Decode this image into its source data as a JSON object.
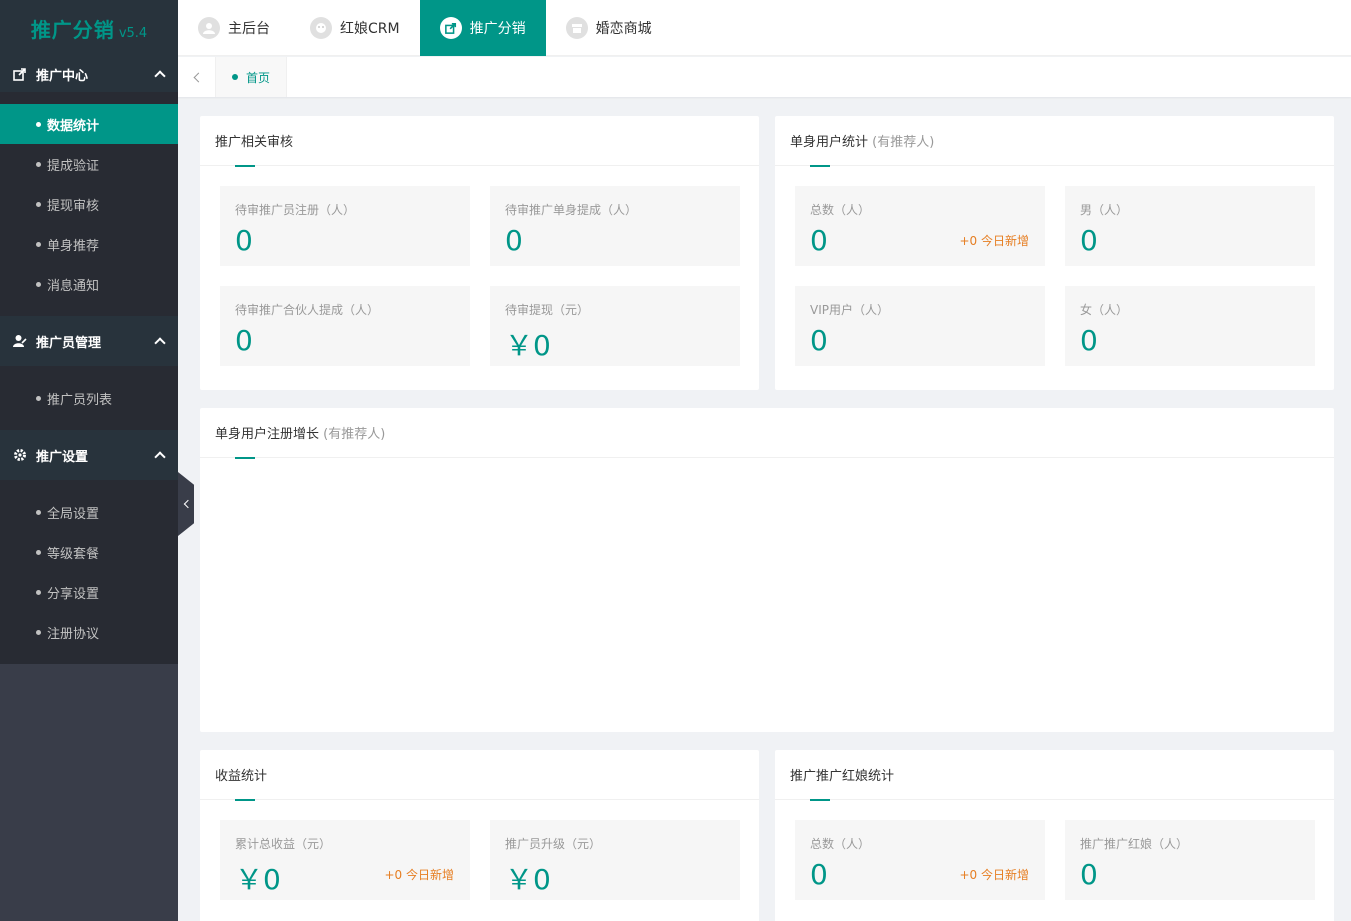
{
  "brand": {
    "title": "推广分销",
    "version": "v5.4"
  },
  "sidebar": {
    "groups": [
      {
        "label": "推广中心",
        "items": [
          "数据统计",
          "提成验证",
          "提现审核",
          "单身推荐",
          "消息通知"
        ]
      },
      {
        "label": "推广员管理",
        "items": [
          "推广员列表"
        ]
      },
      {
        "label": "推广设置",
        "items": [
          "全局设置",
          "等级套餐",
          "分享设置",
          "注册协议"
        ]
      }
    ]
  },
  "topnav": {
    "tabs": [
      "主后台",
      "红娘CRM",
      "推广分销",
      "婚恋商城"
    ],
    "active": "推广分销"
  },
  "breadcrumb": {
    "home": "首页"
  },
  "cards": {
    "audit": {
      "title": "推广相关审核",
      "stats": [
        {
          "label": "待审推广员注册（人）",
          "value": "0"
        },
        {
          "label": "待审推广单身提成（人）",
          "value": "0"
        },
        {
          "label": "待审推广合伙人提成（人）",
          "value": "0"
        },
        {
          "label": "待审提现（元）",
          "value": "￥0"
        }
      ]
    },
    "single_users": {
      "title": "单身用户统计",
      "tag": "(有推荐人)",
      "stats": [
        {
          "label": "总数（人）",
          "value": "0",
          "increment": "+0 今日新增"
        },
        {
          "label": "男（人）",
          "value": "0"
        },
        {
          "label": "VIP用户（人）",
          "value": "0"
        },
        {
          "label": "女（人）",
          "value": "0"
        }
      ]
    },
    "growth": {
      "title": "单身用户注册增长",
      "tag": "(有推荐人)"
    },
    "income": {
      "title": "收益统计",
      "stats": [
        {
          "label": "累计总收益（元）",
          "value": "￥0",
          "increment": "+0 今日新增"
        },
        {
          "label": "推广员升级（元）",
          "value": "￥0"
        }
      ]
    },
    "matchmaker": {
      "title": "推广推广红娘统计",
      "stats": [
        {
          "label": "总数（人）",
          "value": "0",
          "increment": "+0 今日新增"
        },
        {
          "label": "推广推广红娘（人）",
          "value": "0"
        }
      ]
    }
  },
  "colors": {
    "accent": "#009688",
    "sidebar": "#393d49",
    "increment": "#e67e22"
  }
}
